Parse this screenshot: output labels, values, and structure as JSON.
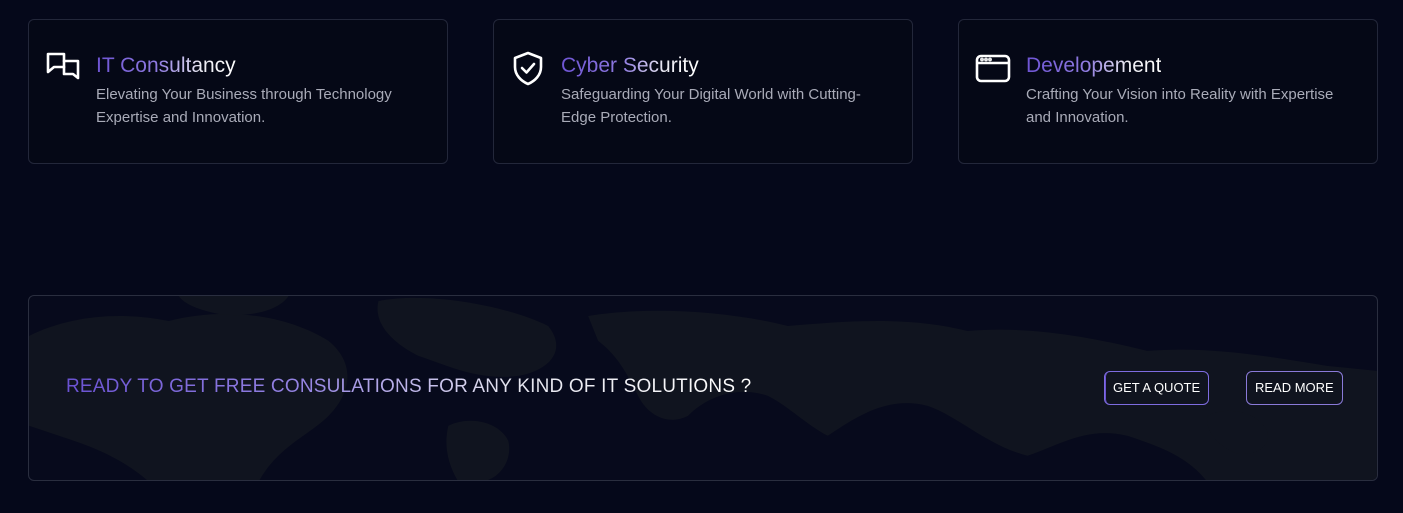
{
  "services": [
    {
      "icon": "chat-bubbles-icon",
      "title": "IT Consultancy",
      "description": "Elevating Your Business through Technology Expertise and Innovation."
    },
    {
      "icon": "shield-check-icon",
      "title": "Cyber Security",
      "description": "Safeguarding Your Digital World with Cutting-Edge Protection."
    },
    {
      "icon": "browser-window-icon",
      "title": "Developement",
      "description": "Crafting Your Vision into Reality with Expertise and Innovation."
    }
  ],
  "cta": {
    "headline": "READY TO GET FREE CONSULATIONS FOR ANY KIND OF IT SOLUTIONS ?",
    "quote_button": "GET A QUOTE",
    "read_more_button": "READ MORE"
  },
  "colors": {
    "background": "#05081a",
    "accent_purple": "#6a52d2",
    "card_border": "#23273a",
    "text_muted": "#a9abb8"
  }
}
